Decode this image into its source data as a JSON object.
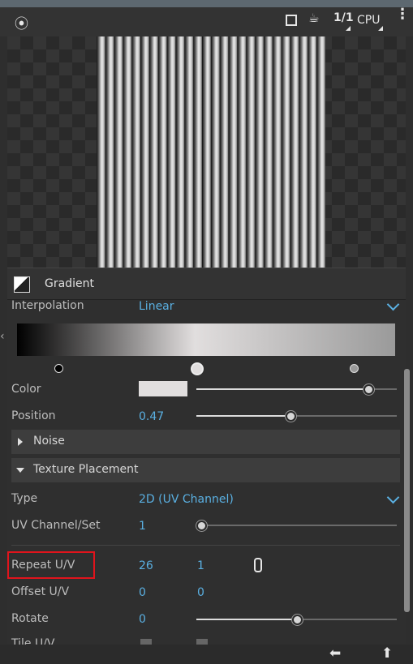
{
  "toolbar": {
    "ratio_label": "1/1",
    "render_mode": "CPU"
  },
  "panel": {
    "title": "Gradient",
    "interpolation": {
      "label": "Interpolation",
      "value": "Linear"
    },
    "gradient": {
      "stops": [
        {
          "color": "#000000",
          "position": 0.0
        },
        {
          "color": "#e1dede",
          "position": 0.47
        },
        {
          "color": "#9a9a9a",
          "position": 1.0
        }
      ],
      "selected_stop": 1
    },
    "color": {
      "label": "Color",
      "swatch": "#e1dede",
      "slider_level": 0.86
    },
    "position": {
      "label": "Position",
      "value": "0.47",
      "slider_level": 0.47
    },
    "noise_section": "Noise",
    "texture_section": "Texture Placement",
    "type": {
      "label": "Type",
      "value": "2D (UV Channel)"
    },
    "uv_channel": {
      "label": "UV Channel/Set",
      "value": "1",
      "slider_level": 0.0
    },
    "repeat_uv": {
      "label": "Repeat U/V",
      "u": "26",
      "v": "1"
    },
    "offset_uv": {
      "label": "Offset U/V",
      "u": "0",
      "v": "0"
    },
    "rotate": {
      "label": "Rotate",
      "value": "0",
      "slider_level": 0.5
    },
    "tile_uv": {
      "label": "Tile U/V"
    }
  },
  "colors": {
    "accent": "#5ab0e2",
    "highlight": "#e0141c"
  }
}
